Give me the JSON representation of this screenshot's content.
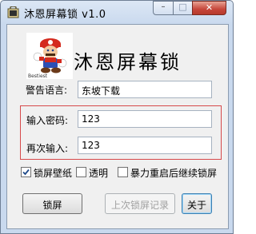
{
  "window": {
    "title": "沐恩屏幕锁 v1.0",
    "controls": {
      "minimize": "–",
      "maximize": "□",
      "close": "✕"
    }
  },
  "header": {
    "app_name": "沐恩屏幕锁",
    "logo_icon": "mario-logo-icon",
    "logo_caption": "Bestiest"
  },
  "form": {
    "warning_label": "警告语言:",
    "warning_value": "东坡下载",
    "password_label": "输入密码:",
    "password_value": "123",
    "confirm_label": "再次输入:",
    "confirm_value": "123"
  },
  "options": [
    {
      "label": "锁屏壁纸",
      "checked": true
    },
    {
      "label": "透明",
      "checked": false
    },
    {
      "label": "暴力重启后继续锁屏",
      "checked": false
    }
  ],
  "buttons": {
    "lock": "锁屏",
    "last_record": "上次锁屏记录",
    "about": "关于"
  },
  "colors": {
    "highlight_border": "#d6494b",
    "window_frame": "#c9d9ee",
    "close_button": "#c6463a"
  }
}
